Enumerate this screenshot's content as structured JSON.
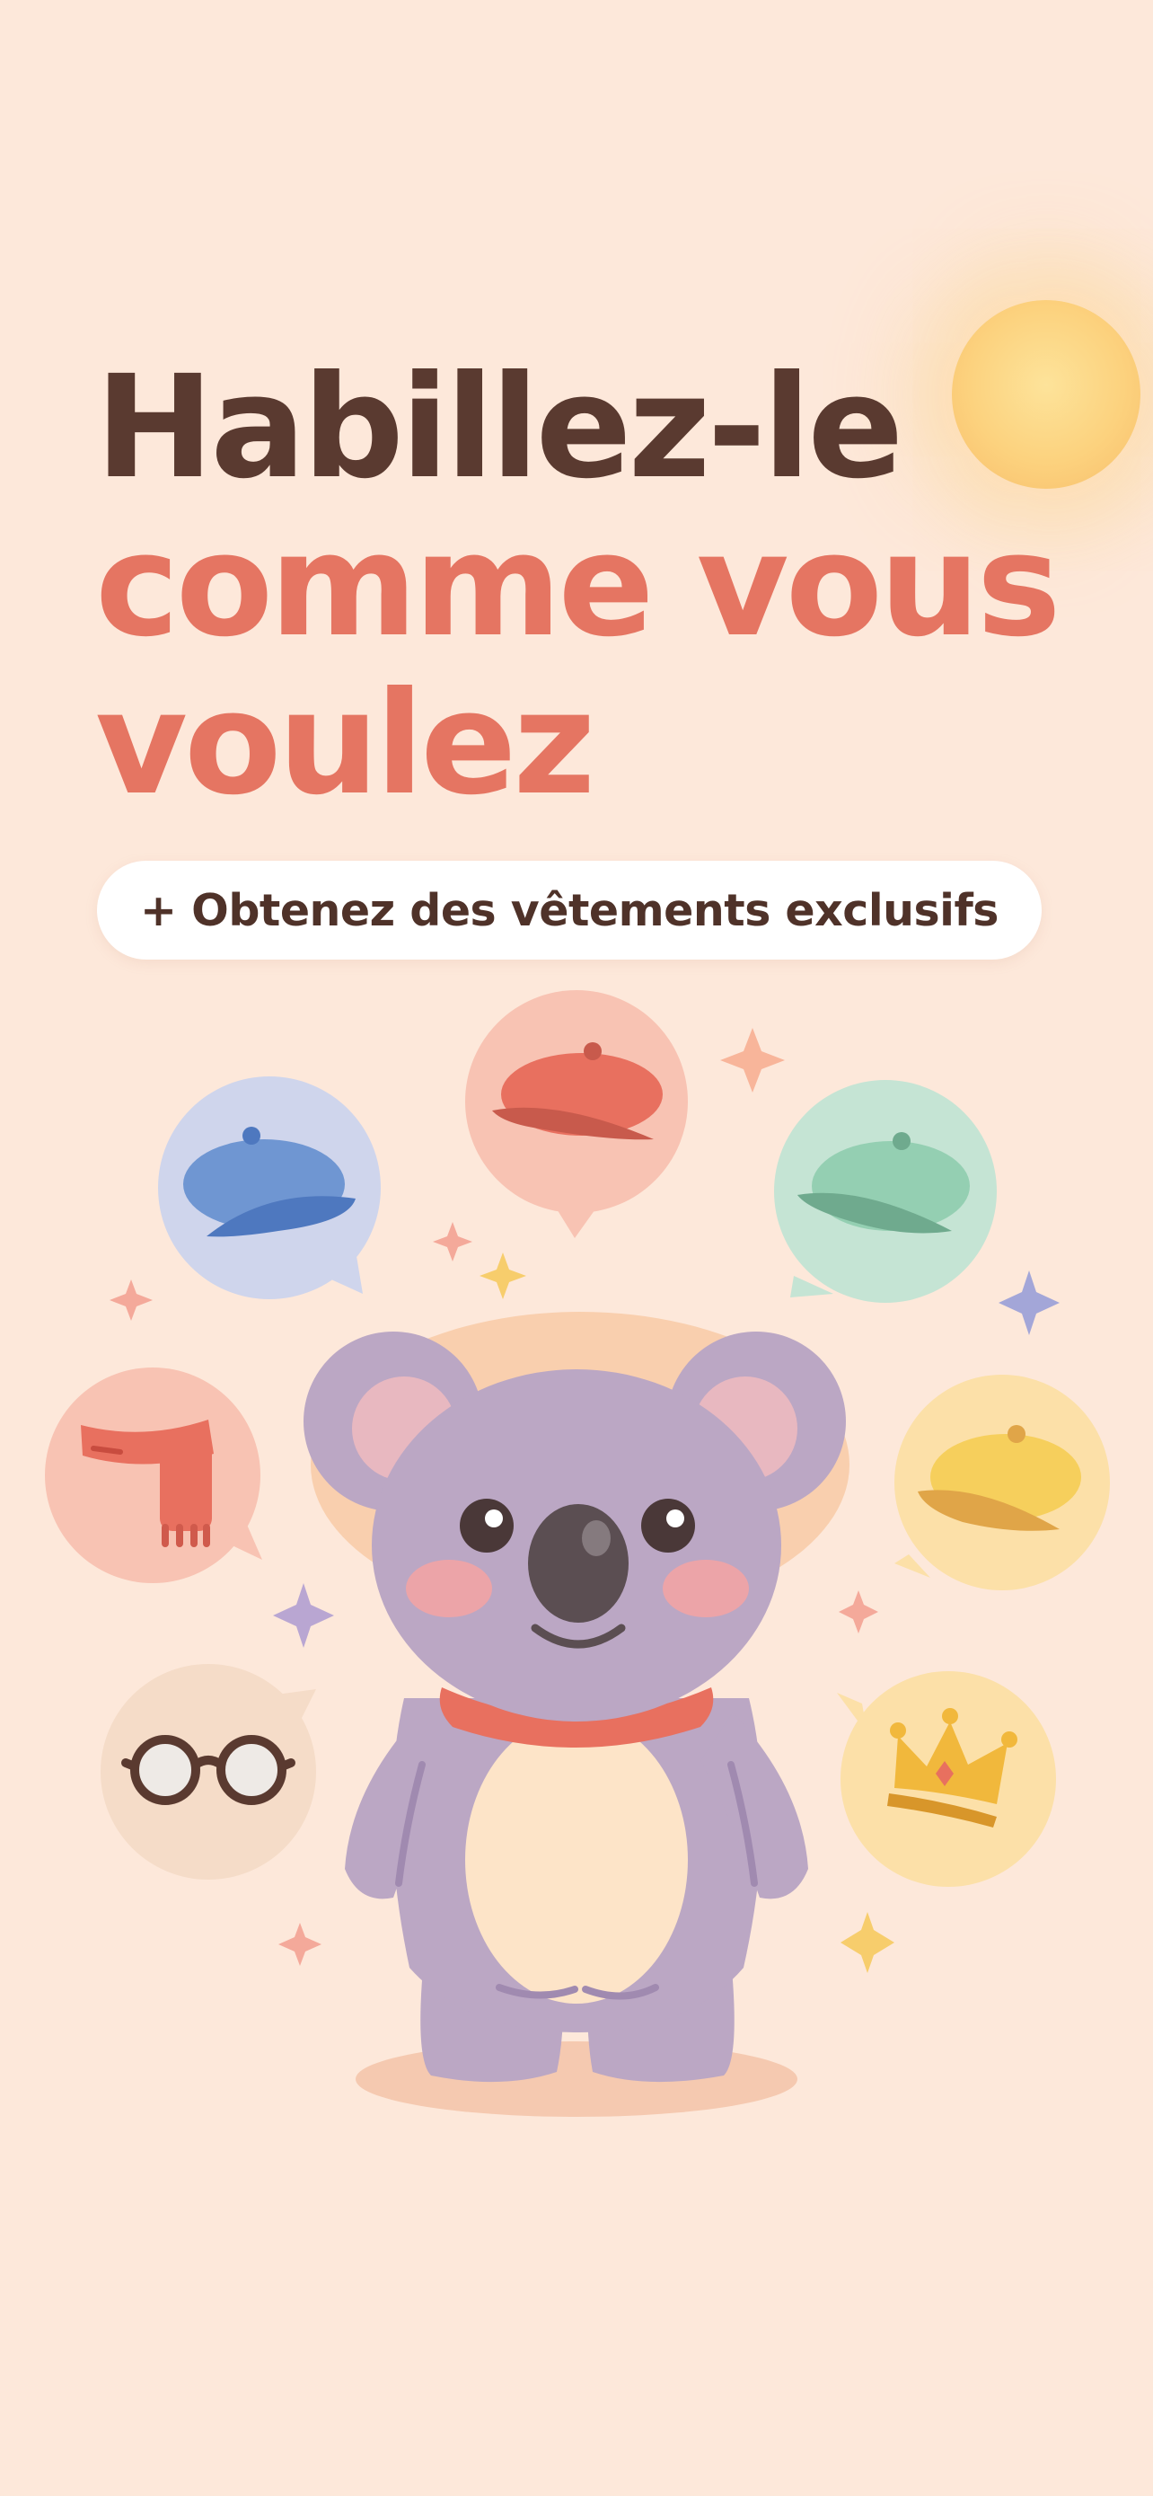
{
  "headline": {
    "line1": "Habillez-le",
    "line2": "comme vous",
    "line3": "voulez"
  },
  "subtitle_pill": {
    "label": "+ Obtenez des vêtements exclusifs"
  },
  "colors": {
    "background": "#fde8da",
    "headline_dark": "#5a3a30",
    "headline_accent": "#e57562",
    "pill_background": "#ffffff"
  },
  "illustration": {
    "character": "koala",
    "accessory_bubbles": [
      "beret-blue",
      "beret-coral",
      "beret-green",
      "scarf",
      "beret-yellow",
      "glasses",
      "crown"
    ]
  }
}
